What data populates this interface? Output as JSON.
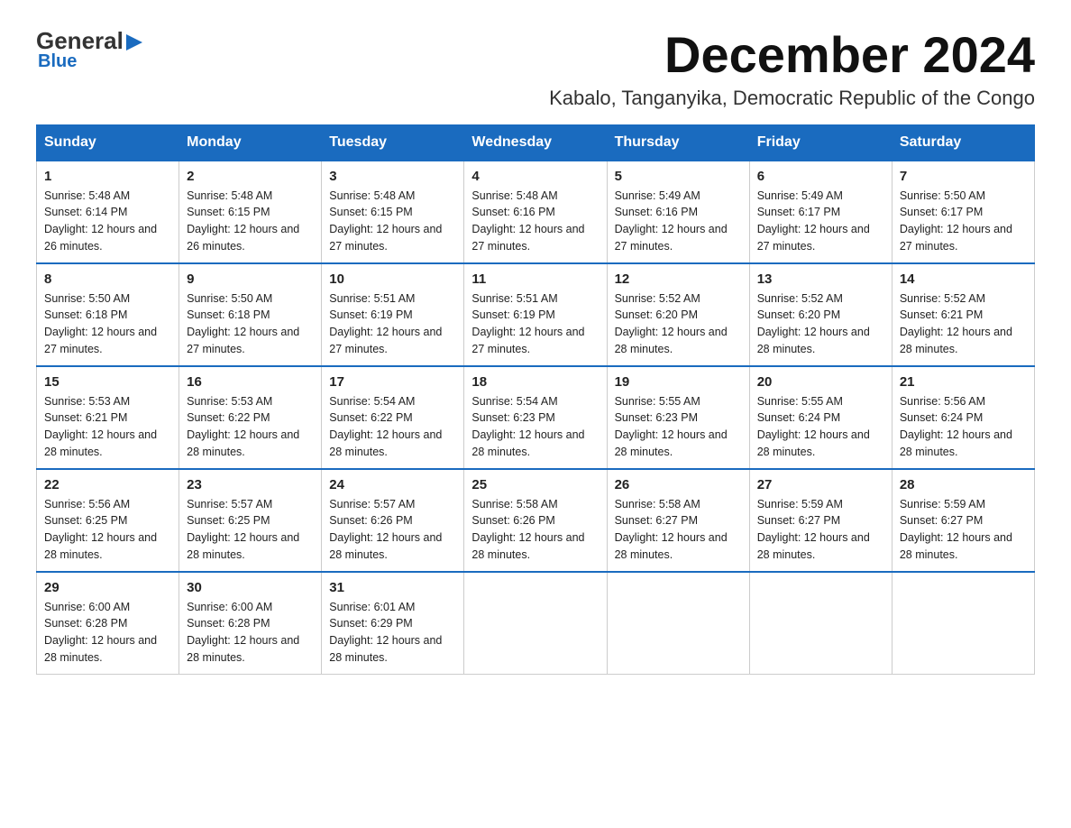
{
  "logo": {
    "general": "General",
    "blue": "Blue",
    "arrow": "▶"
  },
  "title": "December 2024",
  "location": "Kabalo, Tanganyika, Democratic Republic of the Congo",
  "days_of_week": [
    "Sunday",
    "Monday",
    "Tuesday",
    "Wednesday",
    "Thursday",
    "Friday",
    "Saturday"
  ],
  "weeks": [
    [
      {
        "day": "1",
        "sunrise": "5:48 AM",
        "sunset": "6:14 PM",
        "daylight": "12 hours and 26 minutes."
      },
      {
        "day": "2",
        "sunrise": "5:48 AM",
        "sunset": "6:15 PM",
        "daylight": "12 hours and 26 minutes."
      },
      {
        "day": "3",
        "sunrise": "5:48 AM",
        "sunset": "6:15 PM",
        "daylight": "12 hours and 27 minutes."
      },
      {
        "day": "4",
        "sunrise": "5:48 AM",
        "sunset": "6:16 PM",
        "daylight": "12 hours and 27 minutes."
      },
      {
        "day": "5",
        "sunrise": "5:49 AM",
        "sunset": "6:16 PM",
        "daylight": "12 hours and 27 minutes."
      },
      {
        "day": "6",
        "sunrise": "5:49 AM",
        "sunset": "6:17 PM",
        "daylight": "12 hours and 27 minutes."
      },
      {
        "day": "7",
        "sunrise": "5:50 AM",
        "sunset": "6:17 PM",
        "daylight": "12 hours and 27 minutes."
      }
    ],
    [
      {
        "day": "8",
        "sunrise": "5:50 AM",
        "sunset": "6:18 PM",
        "daylight": "12 hours and 27 minutes."
      },
      {
        "day": "9",
        "sunrise": "5:50 AM",
        "sunset": "6:18 PM",
        "daylight": "12 hours and 27 minutes."
      },
      {
        "day": "10",
        "sunrise": "5:51 AM",
        "sunset": "6:19 PM",
        "daylight": "12 hours and 27 minutes."
      },
      {
        "day": "11",
        "sunrise": "5:51 AM",
        "sunset": "6:19 PM",
        "daylight": "12 hours and 27 minutes."
      },
      {
        "day": "12",
        "sunrise": "5:52 AM",
        "sunset": "6:20 PM",
        "daylight": "12 hours and 28 minutes."
      },
      {
        "day": "13",
        "sunrise": "5:52 AM",
        "sunset": "6:20 PM",
        "daylight": "12 hours and 28 minutes."
      },
      {
        "day": "14",
        "sunrise": "5:52 AM",
        "sunset": "6:21 PM",
        "daylight": "12 hours and 28 minutes."
      }
    ],
    [
      {
        "day": "15",
        "sunrise": "5:53 AM",
        "sunset": "6:21 PM",
        "daylight": "12 hours and 28 minutes."
      },
      {
        "day": "16",
        "sunrise": "5:53 AM",
        "sunset": "6:22 PM",
        "daylight": "12 hours and 28 minutes."
      },
      {
        "day": "17",
        "sunrise": "5:54 AM",
        "sunset": "6:22 PM",
        "daylight": "12 hours and 28 minutes."
      },
      {
        "day": "18",
        "sunrise": "5:54 AM",
        "sunset": "6:23 PM",
        "daylight": "12 hours and 28 minutes."
      },
      {
        "day": "19",
        "sunrise": "5:55 AM",
        "sunset": "6:23 PM",
        "daylight": "12 hours and 28 minutes."
      },
      {
        "day": "20",
        "sunrise": "5:55 AM",
        "sunset": "6:24 PM",
        "daylight": "12 hours and 28 minutes."
      },
      {
        "day": "21",
        "sunrise": "5:56 AM",
        "sunset": "6:24 PM",
        "daylight": "12 hours and 28 minutes."
      }
    ],
    [
      {
        "day": "22",
        "sunrise": "5:56 AM",
        "sunset": "6:25 PM",
        "daylight": "12 hours and 28 minutes."
      },
      {
        "day": "23",
        "sunrise": "5:57 AM",
        "sunset": "6:25 PM",
        "daylight": "12 hours and 28 minutes."
      },
      {
        "day": "24",
        "sunrise": "5:57 AM",
        "sunset": "6:26 PM",
        "daylight": "12 hours and 28 minutes."
      },
      {
        "day": "25",
        "sunrise": "5:58 AM",
        "sunset": "6:26 PM",
        "daylight": "12 hours and 28 minutes."
      },
      {
        "day": "26",
        "sunrise": "5:58 AM",
        "sunset": "6:27 PM",
        "daylight": "12 hours and 28 minutes."
      },
      {
        "day": "27",
        "sunrise": "5:59 AM",
        "sunset": "6:27 PM",
        "daylight": "12 hours and 28 minutes."
      },
      {
        "day": "28",
        "sunrise": "5:59 AM",
        "sunset": "6:27 PM",
        "daylight": "12 hours and 28 minutes."
      }
    ],
    [
      {
        "day": "29",
        "sunrise": "6:00 AM",
        "sunset": "6:28 PM",
        "daylight": "12 hours and 28 minutes."
      },
      {
        "day": "30",
        "sunrise": "6:00 AM",
        "sunset": "6:28 PM",
        "daylight": "12 hours and 28 minutes."
      },
      {
        "day": "31",
        "sunrise": "6:01 AM",
        "sunset": "6:29 PM",
        "daylight": "12 hours and 28 minutes."
      },
      null,
      null,
      null,
      null
    ]
  ]
}
